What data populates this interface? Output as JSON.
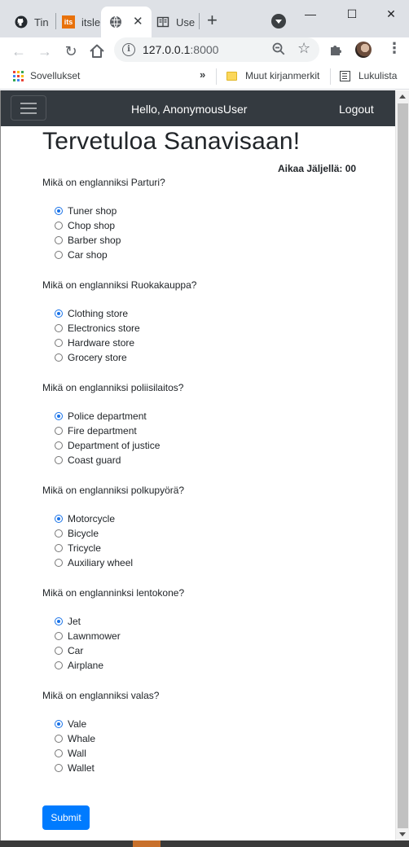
{
  "browser": {
    "tabs": [
      {
        "label": "Tin",
        "icon": "github-icon"
      },
      {
        "label": "itsle",
        "icon": "its-icon"
      },
      {
        "label": "",
        "icon": "globe-icon",
        "active": true
      },
      {
        "label": "Use",
        "icon": "book-icon"
      }
    ],
    "url_host": "127.0.0.1",
    "url_port": ":8000",
    "bookmarks": {
      "apps": "Sovellukset",
      "other": "Muut kirjanmerkit",
      "reading_list": "Lukulista"
    }
  },
  "navbar": {
    "greeting": "Hello, AnonymousUser",
    "logout": "Logout"
  },
  "page": {
    "title": "Tervetuloa Sanavisaan!",
    "timer": "Aikaa Jäljellä: 00",
    "submit_label": "Submit"
  },
  "questions": [
    {
      "text": "Mikä on englanniksi Parturi?",
      "options": [
        "Tuner shop",
        "Chop shop",
        "Barber shop",
        "Car shop"
      ],
      "selected": 0
    },
    {
      "text": "Mikä on englanniksi Ruokakauppa?",
      "options": [
        "Clothing store",
        "Electronics store",
        "Hardware store",
        "Grocery store"
      ],
      "selected": 0
    },
    {
      "text": "Mikä on englanniksi poliisilaitos?",
      "options": [
        "Police department",
        "Fire department",
        "Department of justice",
        "Coast guard"
      ],
      "selected": 0
    },
    {
      "text": "Mikä on englanniksi polkupyörä?",
      "options": [
        "Motorcycle",
        "Bicycle",
        "Tricycle",
        "Auxiliary wheel"
      ],
      "selected": 0
    },
    {
      "text": "Mikä on englanninksi lentokone?",
      "options": [
        "Jet",
        "Lawnmower",
        "Car",
        "Airplane"
      ],
      "selected": 0
    },
    {
      "text": "Mikä on englanniksi valas?",
      "options": [
        "Vale",
        "Whale",
        "Wall",
        "Wallet"
      ],
      "selected": 0
    }
  ],
  "colors": {
    "navbar_bg": "#343a40",
    "submit_bg": "#007bff",
    "radio_checked": "#1a73e8"
  }
}
